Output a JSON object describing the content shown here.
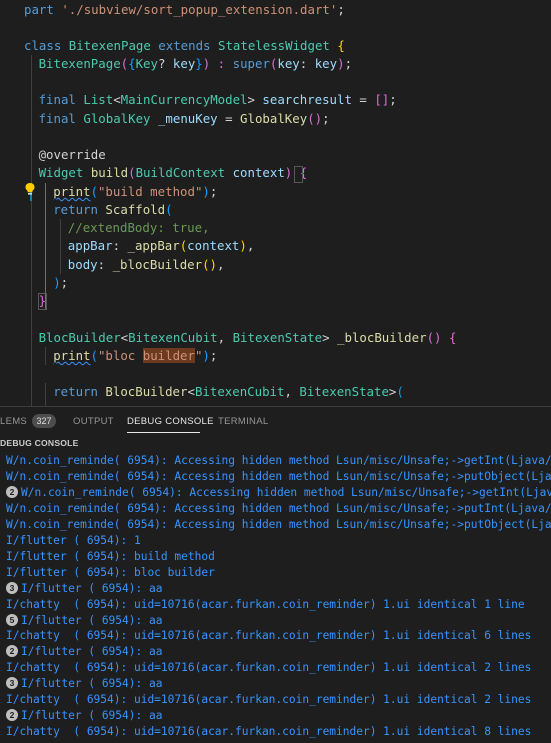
{
  "editor": {
    "lines": [
      [
        [
          "part ",
          "kw"
        ],
        [
          "'./subview/sort_popup_extension.dart'",
          "str"
        ],
        [
          ";",
          "pn"
        ]
      ],
      [],
      [
        [
          "class ",
          "kw"
        ],
        [
          "BitexenPage ",
          "cls"
        ],
        [
          "extends ",
          "kw"
        ],
        [
          "StatelessWidget ",
          "cls"
        ],
        [
          "{",
          "br1"
        ]
      ],
      [
        [
          "BitexenPage",
          "cls"
        ],
        [
          "(",
          "br2"
        ],
        [
          "{",
          "br3"
        ],
        [
          "Key",
          "cls"
        ],
        [
          "? ",
          "pn"
        ],
        [
          "key",
          "var"
        ],
        [
          "}",
          "br3"
        ],
        [
          ") : ",
          "br2"
        ],
        [
          "super",
          "kw"
        ],
        [
          "(",
          "br2"
        ],
        [
          "key",
          "var"
        ],
        [
          ": ",
          "pn"
        ],
        [
          "key",
          "var"
        ],
        [
          ")",
          "br2"
        ],
        [
          ";",
          "pn"
        ]
      ],
      [],
      [
        [
          "final ",
          "kw"
        ],
        [
          "List",
          "cls"
        ],
        [
          "<",
          "pn"
        ],
        [
          "MainCurrencyModel",
          "cls"
        ],
        [
          "> ",
          "pn"
        ],
        [
          "searchresult",
          "var"
        ],
        [
          " = ",
          "pn"
        ],
        [
          "[]",
          "br2"
        ],
        [
          ";",
          "pn"
        ]
      ],
      [
        [
          "final ",
          "kw"
        ],
        [
          "GlobalKey ",
          "cls"
        ],
        [
          "_menuKey",
          "var"
        ],
        [
          " = ",
          "pn"
        ],
        [
          "GlobalKey",
          "fn"
        ],
        [
          "()",
          "br2"
        ],
        [
          ";",
          "pn"
        ]
      ],
      [],
      [
        [
          "@override",
          "pn"
        ]
      ],
      [
        [
          "Widget ",
          "cls"
        ],
        [
          "build",
          "fn"
        ],
        [
          "(",
          "br2"
        ],
        [
          "BuildContext ",
          "cls"
        ],
        [
          "context",
          "var"
        ],
        [
          ")",
          "br2"
        ],
        [
          " ",
          "pn"
        ],
        [
          "{",
          "br2"
        ]
      ],
      [
        [
          "print",
          "fn",
          "squig"
        ],
        [
          "(",
          "br3"
        ],
        [
          "\"build method\"",
          "str"
        ],
        [
          ")",
          "br3"
        ],
        [
          ";",
          "pn"
        ]
      ],
      [
        [
          "return ",
          "kw"
        ],
        [
          "Scaffold",
          "fn"
        ],
        [
          "(",
          "br3"
        ]
      ],
      [
        [
          "//extendBody: true,",
          "cm"
        ]
      ],
      [
        [
          "appBar",
          "var"
        ],
        [
          ": ",
          "pn"
        ],
        [
          "_appBar",
          "fn"
        ],
        [
          "(",
          "br1"
        ],
        [
          "context",
          "var"
        ],
        [
          ")",
          "br1"
        ],
        [
          ",",
          "pn"
        ]
      ],
      [
        [
          "body",
          "var"
        ],
        [
          ": ",
          "pn"
        ],
        [
          "_blocBuilder",
          "fn"
        ],
        [
          "()",
          "br1"
        ],
        [
          ",",
          "pn"
        ]
      ],
      [
        [
          ")",
          "br3"
        ],
        [
          ";",
          "pn"
        ]
      ],
      [
        [
          "}",
          "br2"
        ]
      ],
      [],
      [
        [
          "BlocBuilder",
          "cls"
        ],
        [
          "<",
          "pn"
        ],
        [
          "BitexenCubit",
          "cls"
        ],
        [
          ", ",
          "pn"
        ],
        [
          "BitexenState",
          "cls"
        ],
        [
          "> ",
          "pn"
        ],
        [
          "_blocBuilder",
          "fn"
        ],
        [
          "()",
          "br2"
        ],
        [
          " ",
          "pn"
        ],
        [
          "{",
          "br2"
        ]
      ],
      [
        [
          "print",
          "fn",
          "squig"
        ],
        [
          "(",
          "br3"
        ],
        [
          "\"bloc ",
          "str"
        ],
        [
          "builder",
          "str",
          "hl"
        ],
        [
          "\"",
          "str"
        ],
        [
          ")",
          "br3"
        ],
        [
          ";",
          "pn"
        ]
      ],
      [],
      [
        [
          "return ",
          "kw"
        ],
        [
          "BlocBuilder",
          "fn"
        ],
        [
          "<",
          "pn"
        ],
        [
          "BitexenCubit",
          "cls"
        ],
        [
          ", ",
          "pn"
        ],
        [
          "BitexenState",
          "cls"
        ],
        [
          ">",
          "pn"
        ],
        [
          "(",
          "br3"
        ]
      ]
    ]
  },
  "panel": {
    "tabs": {
      "problems": "LEMS",
      "problems_count": "327",
      "output": "OUTPUT",
      "debug_console": "DEBUG CONSOLE",
      "terminal": "TERMINAL"
    },
    "console_title": "DEBUG CONSOLE"
  },
  "console": {
    "lines": [
      {
        "count": "",
        "text": "W/n.coin_reminde( 6954): Accessing hidden method Lsun/misc/Unsafe;->getInt(Ljava/lang"
      },
      {
        "count": "",
        "text": "W/n.coin_reminde( 6954): Accessing hidden method Lsun/misc/Unsafe;->putObject(Ljava/l"
      },
      {
        "count": "2",
        "text": "W/n.coin_reminde( 6954): Accessing hidden method Lsun/misc/Unsafe;->getInt(Ljava/l"
      },
      {
        "count": "",
        "text": "W/n.coin_reminde( 6954): Accessing hidden method Lsun/misc/Unsafe;->putInt(Ljava/lang"
      },
      {
        "count": "",
        "text": "W/n.coin_reminde( 6954): Accessing hidden method Lsun/misc/Unsafe;->putObject(Ljava/l"
      },
      {
        "count": "",
        "text": "I/flutter ( 6954): 1"
      },
      {
        "count": "",
        "text": "I/flutter ( 6954): build method"
      },
      {
        "count": "",
        "text": "I/flutter ( 6954): bloc builder"
      },
      {
        "count": "3",
        "text": "I/flutter ( 6954): aa"
      },
      {
        "count": "",
        "text": "I/chatty  ( 6954): uid=10716(acar.furkan.coin_reminder) 1.ui identical 1 line"
      },
      {
        "count": "5",
        "text": "I/flutter ( 6954): aa"
      },
      {
        "count": "",
        "text": "I/chatty  ( 6954): uid=10716(acar.furkan.coin_reminder) 1.ui identical 6 lines"
      },
      {
        "count": "2",
        "text": "I/flutter ( 6954): aa"
      },
      {
        "count": "",
        "text": "I/chatty  ( 6954): uid=10716(acar.furkan.coin_reminder) 1.ui identical 2 lines"
      },
      {
        "count": "3",
        "text": "I/flutter ( 6954): aa"
      },
      {
        "count": "",
        "text": "I/chatty  ( 6954): uid=10716(acar.furkan.coin_reminder) 1.ui identical 2 lines"
      },
      {
        "count": "2",
        "text": "I/flutter ( 6954): aa"
      },
      {
        "count": "",
        "text": "I/chatty  ( 6954): uid=10716(acar.furkan.coin_reminder) 1.ui identical 8 lines"
      }
    ]
  }
}
